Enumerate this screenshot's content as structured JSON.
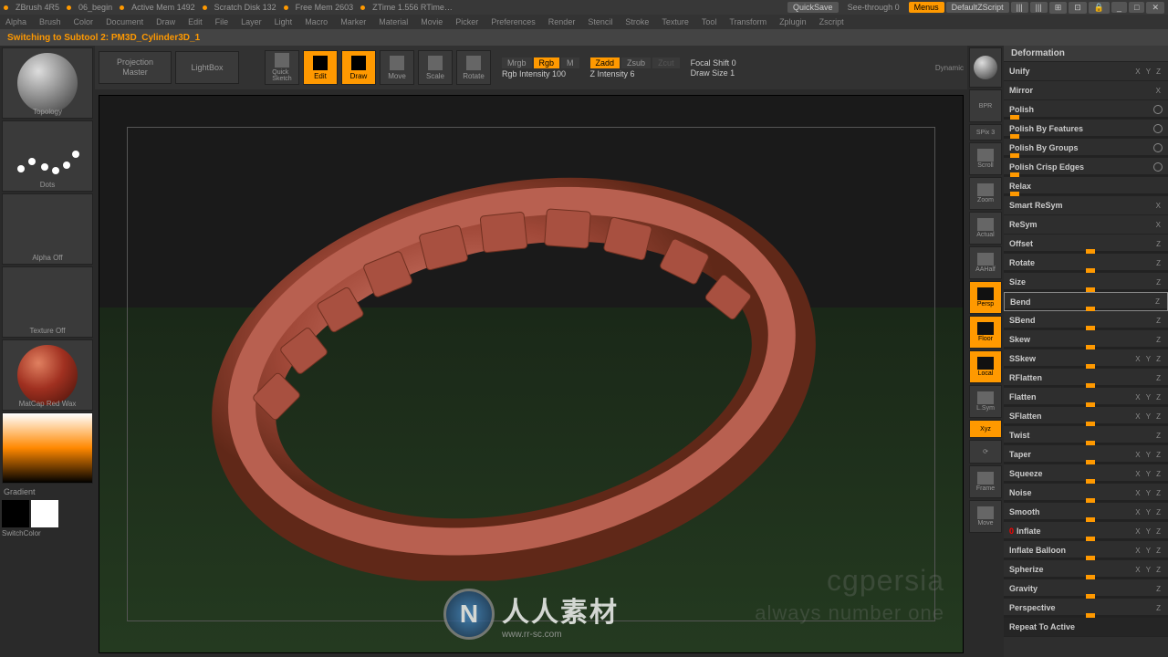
{
  "topbar": {
    "app": "ZBrush 4R5",
    "file": "06_begin",
    "mem": "Active Mem 1492",
    "scratch": "Scratch Disk 132",
    "free": "Free Mem 2603",
    "ztime": "ZTime 1.556 RTime…",
    "quicksave": "QuickSave",
    "seethrough": "See-through  0",
    "menus": "Menus",
    "script": "DefaultZScript"
  },
  "menu": [
    "Alpha",
    "Brush",
    "Color",
    "Document",
    "Draw",
    "Edit",
    "File",
    "Layer",
    "Light",
    "Macro",
    "Marker",
    "Material",
    "Movie",
    "Picker",
    "Preferences",
    "Render",
    "Stencil",
    "Stroke",
    "Texture",
    "Tool",
    "Transform",
    "Zplugin",
    "Zscript"
  ],
  "status": "Switching to Subtool 2:   PM3D_Cylinder3D_1",
  "controls": {
    "projection": "Projection\nMaster",
    "lightbox": "LightBox",
    "quicksketch": "Quick\nSketch",
    "edit": "Edit",
    "draw": "Draw",
    "move": "Move",
    "scale": "Scale",
    "rotate": "Rotate",
    "mrgb": "Mrgb",
    "rgb": "Rgb",
    "m": "M",
    "rgbint": "Rgb Intensity 100",
    "zadd": "Zadd",
    "zsub": "Zsub",
    "zcut": "Zcut",
    "zint": "Z Intensity 6",
    "focal": "Focal Shift 0",
    "drawsize": "Draw Size 1",
    "dynamic": "Dynamic"
  },
  "left": {
    "topology": "Topology",
    "dots": "Dots",
    "alpha": "Alpha Off",
    "texture": "Texture Off",
    "material": "MatCap Red Wax",
    "gradient": "Gradient",
    "switchcolor": "SwitchColor"
  },
  "rightvert": {
    "bpr": "BPR",
    "spix": "SPix 3",
    "scroll": "Scroll",
    "zoom": "Zoom",
    "actual": "Actual",
    "aahalf": "AAHalf",
    "persp": "Persp",
    "floor": "Floor",
    "local": "Local",
    "lsym": "L.Sym",
    "xyz": "Xyz",
    "frame": "Frame",
    "move": "Move"
  },
  "defpanel": {
    "title": "Deformation",
    "unify": "Unify",
    "mirror": "Mirror",
    "polish": "Polish",
    "polishfeat": "Polish By Features",
    "polishgrp": "Polish By Groups",
    "polishcrisp": "Polish Crisp Edges",
    "relax": "Relax",
    "smartresym": "Smart ReSym",
    "resym": "ReSym",
    "offset": "Offset",
    "rotate": "Rotate",
    "size": "Size",
    "bend": "Bend",
    "sbend": "SBend",
    "skew": "Skew",
    "sskew": "SSkew",
    "rflatten": "RFlatten",
    "flatten": "Flatten",
    "sflatten": "SFlatten",
    "twist": "Twist",
    "taper": "Taper",
    "squeeze": "Squeeze",
    "noise": "Noise",
    "smooth": "Smooth",
    "inflate": "Inflate",
    "inflatebal": "Inflate Balloon",
    "spherize": "Spherize",
    "gravity": "Gravity",
    "perspective": "Perspective",
    "repeat": "Repeat To Active"
  },
  "axes": {
    "xyz": "X Y Z",
    "z": "Z"
  },
  "watermark": {
    "icon": "N",
    "text1": "人人素材",
    "text2": "www.rr-sc.com",
    "wm2": "cgpersia",
    "wm3": "always number one"
  }
}
